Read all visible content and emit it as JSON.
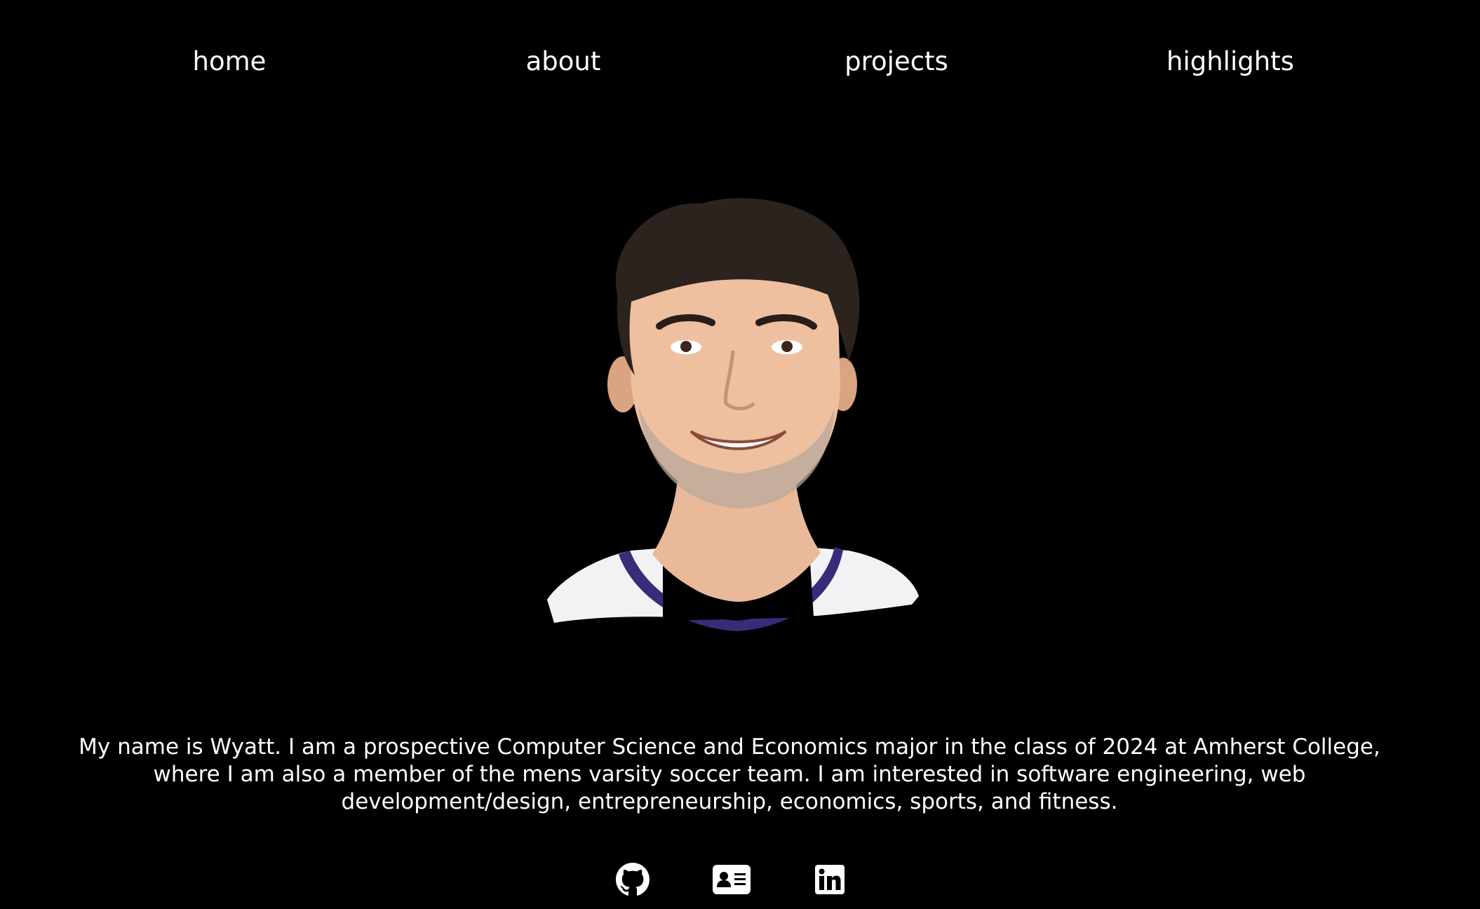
{
  "nav": {
    "items": [
      {
        "label": "home"
      },
      {
        "label": "about"
      },
      {
        "label": "projects"
      },
      {
        "label": "highlights"
      }
    ]
  },
  "bio": {
    "text": "My name is Wyatt. I am a prospective Computer Science and Economics major in the class of 2024 at Amherst College, where I am also a member of the mens varsity soccer team. I am interested in software engineering, web development/design, entrepreneurship, economics, sports, and fitness."
  },
  "socials": [
    {
      "icon": "github-icon"
    },
    {
      "icon": "id-card-icon"
    },
    {
      "icon": "linkedin-icon"
    }
  ],
  "colors": {
    "background": "#000000",
    "text": "#ffffff",
    "jersey_trim": "#3a2a7a"
  }
}
